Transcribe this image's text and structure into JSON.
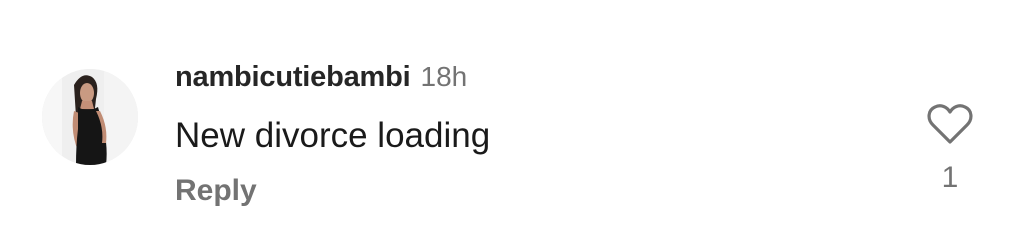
{
  "comment": {
    "avatar_icon": "user-avatar-photo",
    "username": "nambicutiebambi",
    "timestamp": "18h",
    "text": "New divorce loading",
    "reply_label": "Reply",
    "like_icon": "heart-outline-icon",
    "like_count": "1"
  },
  "colors": {
    "username": "#262626",
    "secondary_text": "#737373",
    "body_text": "#1a1a1a",
    "icon_stroke": "#737373"
  }
}
